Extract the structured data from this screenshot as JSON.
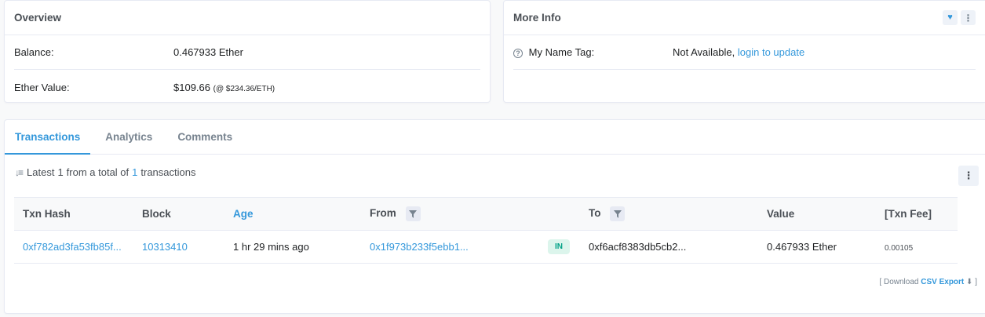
{
  "overview": {
    "title": "Overview",
    "balance_label": "Balance:",
    "balance_value": "0.467933 Ether",
    "ether_value_label": "Ether Value:",
    "ether_value_amount": "$109.66",
    "ether_value_rate": "(@ $234.36/ETH)"
  },
  "more_info": {
    "title": "More Info",
    "name_tag_label": "My Name Tag:",
    "name_tag_value": "Not Available,",
    "name_tag_link": "login to update"
  },
  "tabs": [
    {
      "label": "Transactions",
      "active": true
    },
    {
      "label": "Analytics",
      "active": false
    },
    {
      "label": "Comments",
      "active": false
    }
  ],
  "summary": {
    "prefix": "Latest",
    "count": "1",
    "middle": "from a total of",
    "total": "1",
    "suffix": "transactions"
  },
  "table": {
    "headers": [
      "Txn Hash",
      "Block",
      "Age",
      "From",
      "",
      "To",
      "Value",
      "[Txn Fee]"
    ],
    "rows": [
      {
        "hash": "0xf782ad3fa53fb85f...",
        "block": "10313410",
        "age": "1 hr 29 mins ago",
        "from": "0x1f973b233f5ebb1...",
        "direction": "IN",
        "to": "0xf6acf8383db5cb2...",
        "value": "0.467933 Ether",
        "fee": "0.00105"
      }
    ]
  },
  "download": {
    "open": "[ Download",
    "csv": "CSV Export",
    "close": "]"
  },
  "colors": {
    "accent": "#3498db",
    "in_badge_bg": "#dcf5ec",
    "in_badge_text": "#00a186"
  }
}
